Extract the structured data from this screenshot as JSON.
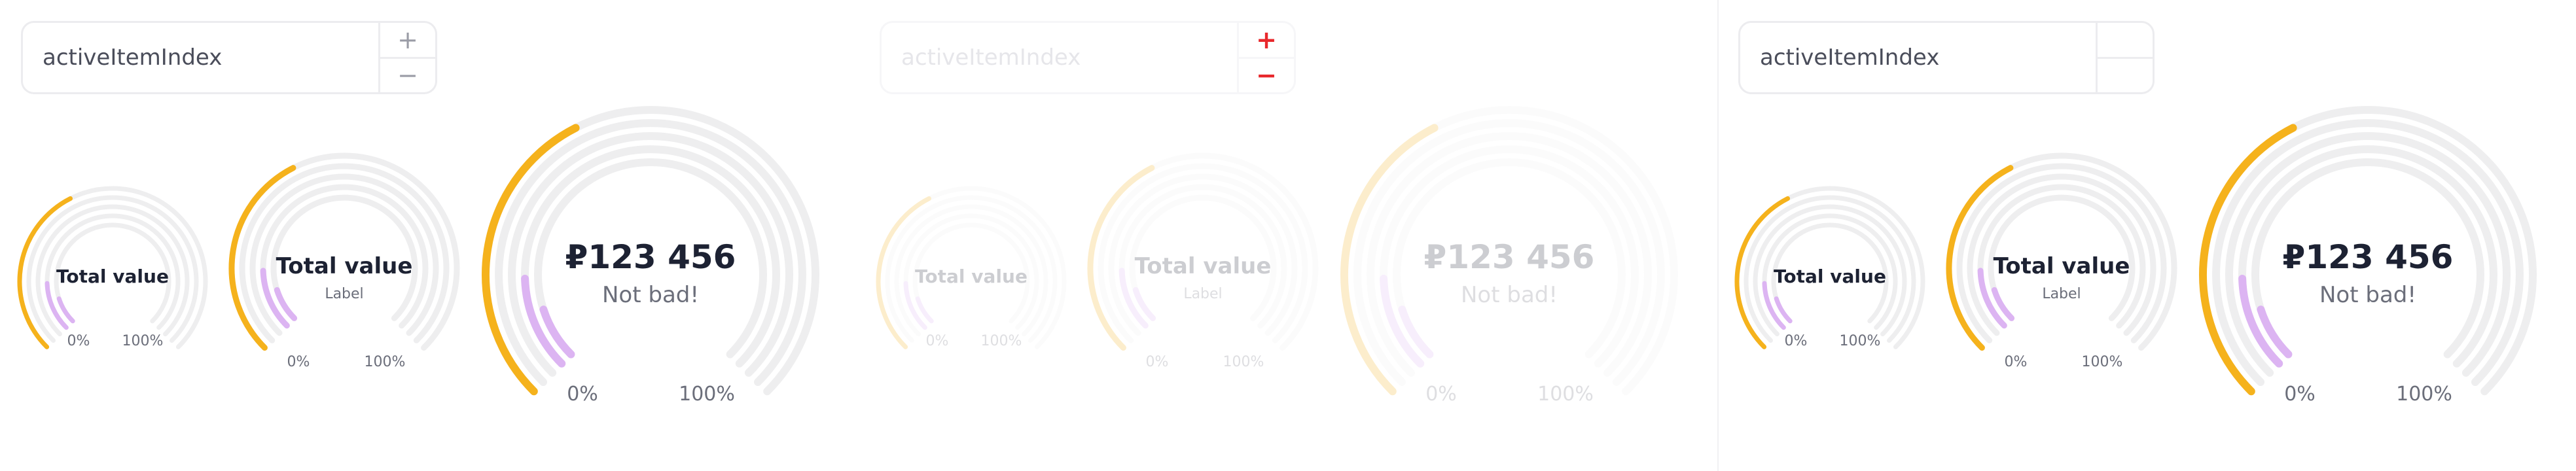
{
  "stepper": {
    "placeholder": "activeItemIndex",
    "increment_symbol": "+",
    "decrement_symbol": "−"
  },
  "gauges": {
    "small": {
      "title": "Total value",
      "min_label": "0%",
      "max_label": "100%"
    },
    "medium": {
      "title": "Total value",
      "subtitle": "Label",
      "min_label": "0%",
      "max_label": "100%"
    },
    "large": {
      "value": "₽123 456",
      "caption": "Not bad!",
      "min_label": "0%",
      "max_label": "100%"
    }
  },
  "colors": {
    "accent_yellow": "#f5b21c",
    "accent_purple": "#dcb4f2",
    "track": "#eeeeef",
    "danger": "#e8282c"
  }
}
